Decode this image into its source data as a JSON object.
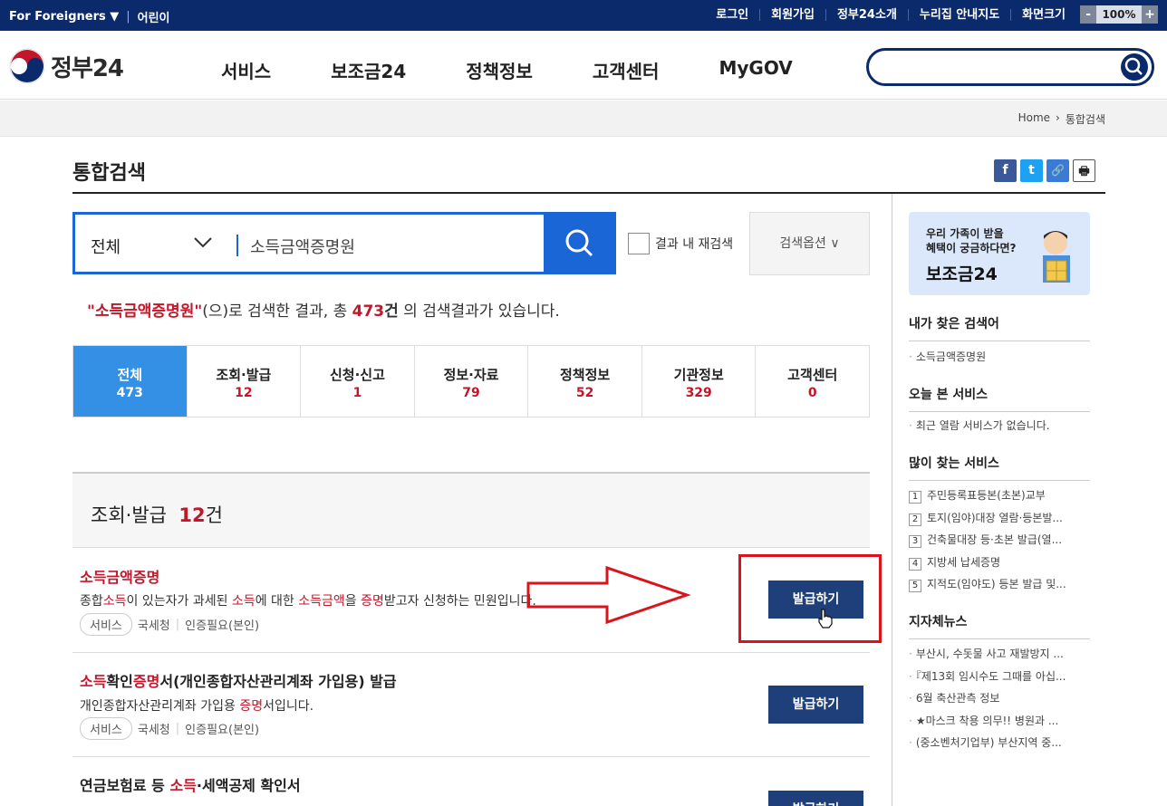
{
  "topbar": {
    "foreign": "For Foreigners ▼",
    "kids": "어린이",
    "links": [
      "로그인",
      "회원가입",
      "정부24소개",
      "누리집 안내지도",
      "화면크기"
    ],
    "zoom_minus": "-",
    "zoom_value": "100%",
    "zoom_plus": "+"
  },
  "header": {
    "logo": "정부24",
    "nav": [
      "서비스",
      "보조금24",
      "정책정보",
      "고객센터",
      "MyGOV"
    ]
  },
  "breadcrumb": {
    "home": "Home",
    "sep": "›",
    "current": "통합검색"
  },
  "page": {
    "title": "통합검색"
  },
  "sns": [
    "f",
    "t",
    "🔗",
    "🖶"
  ],
  "search": {
    "category": "전체",
    "query": "소득금액증명원",
    "recheck": "결과 내 재검색",
    "options": "검색옵션 ∨"
  },
  "result": {
    "kw": "\"소득금액증명원\"",
    "t1": "(으)로 검색한 결과, 총 ",
    "count": "473",
    "unit": "건",
    "t2": " 의 검색결과가 있습니다."
  },
  "tabs": [
    {
      "label": "전체",
      "count": "473"
    },
    {
      "label": "조회·발급",
      "count": "12"
    },
    {
      "label": "신청·신고",
      "count": "1"
    },
    {
      "label": "정보·자료",
      "count": "79"
    },
    {
      "label": "정책정보",
      "count": "52"
    },
    {
      "label": "기관정보",
      "count": "329"
    },
    {
      "label": "고객센터",
      "count": "0"
    }
  ],
  "section": {
    "title": "조회·발급",
    "count": "12",
    "unit": "건"
  },
  "items": [
    {
      "title": [
        "소득금액증명"
      ],
      "desc": [
        "종합",
        "소득",
        "이 있는자가 과세된 ",
        "소득",
        "에 대한 ",
        "소득금액",
        "을 ",
        "증명",
        "받고자 신청하는 민원입니다."
      ],
      "tag": "서비스",
      "org": "국세청",
      "auth": "인증필요(본인)",
      "btn": "발급하기"
    },
    {
      "title": [
        "소득",
        "확인",
        "증명",
        "서(개인종합자산관리계좌 가입용) 발급"
      ],
      "desc": [
        "개인종합자산관리계좌 가입용 ",
        "증명",
        "서입니다."
      ],
      "tag": "서비스",
      "org": "국세청",
      "auth": "인증필요(본인)",
      "btn": "발급하기"
    },
    {
      "title": [
        "연금보험료 등 ",
        "소득",
        "·세액공제 확인서"
      ],
      "btn": "발급하기"
    }
  ],
  "sidebar": {
    "banner_line1": "우리 가족이 받을",
    "banner_line2": "혜택이 궁금하다면?",
    "banner_title": "보조금24",
    "recent_title": "내가 찾은 검색어",
    "recent": [
      "소득금액증명원"
    ],
    "today_title": "오늘 본 서비스",
    "today": [
      "최근 열람 서비스가 없습니다."
    ],
    "popular_title": "많이 찾는 서비스",
    "popular": [
      "주민등록표등본(초본)교부",
      "토지(임야)대장 열람·등본발...",
      "건축물대장 등·초본 발급(열...",
      "지방세 납세증명",
      "지적도(임야도) 등본 발급 및..."
    ],
    "news_title": "지자체뉴스",
    "news": [
      "부산시, 수돗물 사고 재발방지 ...",
      "『제13회 임시수도 그때를 아십...",
      "6월 축산관측 정보",
      "★마스크 착용 의무!! 병원과 ...",
      "(중소벤처기업부) 부산지역 중..."
    ]
  },
  "colors": {
    "navy": "#0b2a6b",
    "blue": "#1a66d6",
    "tab_active": "#3490e4",
    "highlight": "#c4162a",
    "button": "#1e3f7a",
    "annotation": "#d9141c"
  }
}
